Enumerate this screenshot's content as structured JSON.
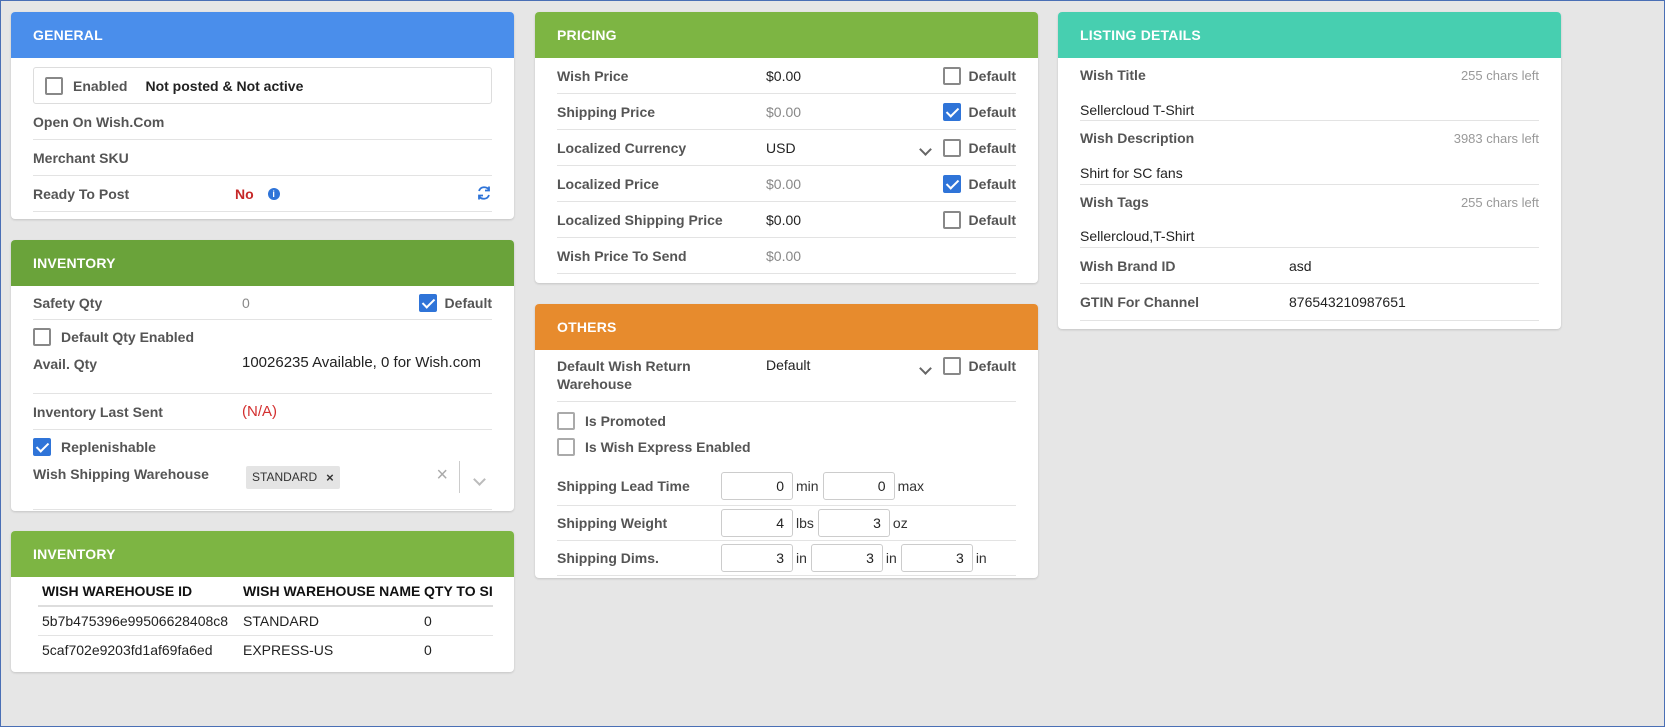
{
  "general": {
    "title": "GENERAL",
    "color": "#4a8eeb",
    "enabled_label": "Enabled",
    "status_text": "Not posted & Not active",
    "open_on_label": "Open On Wish.Com",
    "merchant_sku_label": "Merchant SKU",
    "ready_to_post_label": "Ready To Post",
    "ready_to_post_value": "No"
  },
  "inventory": {
    "title": "INVENTORY",
    "color": "#6aa33a",
    "safety_qty_label": "Safety Qty",
    "safety_qty_value": "0",
    "default_label": "Default",
    "default_qty_enabled_label": "Default Qty Enabled",
    "avail_qty_label": "Avail. Qty",
    "avail_qty_value": "10026235 Available, 0 for Wish.com",
    "inventory_last_sent_label": "Inventory Last Sent",
    "inventory_last_sent_value": "(N/A)",
    "replenishable_label": "Replenishable",
    "shipping_warehouse_label": "Wish Shipping Warehouse",
    "shipping_warehouse_tag": "STANDARD"
  },
  "inventory_table": {
    "title": "INVENTORY",
    "color": "#7db543",
    "headers": [
      "WISH WAREHOUSE ID",
      "WISH WAREHOUSE NAME",
      "QTY TO SI"
    ],
    "rows": [
      [
        "5b7b475396e99506628408c8",
        "STANDARD",
        "0"
      ],
      [
        "5caf702e9203fd1af69fa6ed",
        "EXPRESS-US",
        "0"
      ]
    ]
  },
  "pricing": {
    "title": "PRICING",
    "color": "#7db543",
    "default_label": "Default",
    "wish_price_label": "Wish Price",
    "wish_price_value": "$0.00",
    "shipping_price_label": "Shipping Price",
    "shipping_price_value": "$0.00",
    "localized_currency_label": "Localized Currency",
    "localized_currency_value": "USD",
    "localized_price_label": "Localized Price",
    "localized_price_value": "$0.00",
    "localized_shipping_price_label": "Localized Shipping Price",
    "localized_shipping_price_value": "$0.00",
    "wish_price_to_send_label": "Wish Price To Send",
    "wish_price_to_send_value": "$0.00"
  },
  "others": {
    "title": "OTHERS",
    "color": "#e78b2d",
    "default_label": "Default",
    "return_warehouse_label": "Default Wish Return Warehouse",
    "return_warehouse_value": "Default",
    "is_promoted_label": "Is Promoted",
    "is_wish_express_label": "Is Wish Express Enabled",
    "lead_time_label": "Shipping Lead Time",
    "lead_time_min": "0",
    "lead_time_min_unit": "min",
    "lead_time_max": "0",
    "lead_time_max_unit": "max",
    "weight_label": "Shipping Weight",
    "weight_lbs": "4",
    "weight_lbs_unit": "lbs",
    "weight_oz": "3",
    "weight_oz_unit": "oz",
    "dims_label": "Shipping Dims.",
    "dim1": "3",
    "dim2": "3",
    "dim3": "3",
    "dim_unit": "in"
  },
  "listing": {
    "title": "LISTING DETAILS",
    "color": "#47cfb0",
    "wish_title_label": "Wish Title",
    "wish_title_chars": "255 chars left",
    "wish_title_value": "Sellercloud T-Shirt",
    "wish_description_label": "Wish Description",
    "wish_description_chars": "3983 chars left",
    "wish_description_value": "Shirt for SC fans",
    "wish_tags_label": "Wish Tags",
    "wish_tags_chars": "255 chars left",
    "wish_tags_value": "Sellercloud,T-Shirt",
    "brand_id_label": "Wish Brand ID",
    "brand_id_value": "asd",
    "gtin_label": "GTIN For Channel",
    "gtin_value": "876543210987651"
  }
}
